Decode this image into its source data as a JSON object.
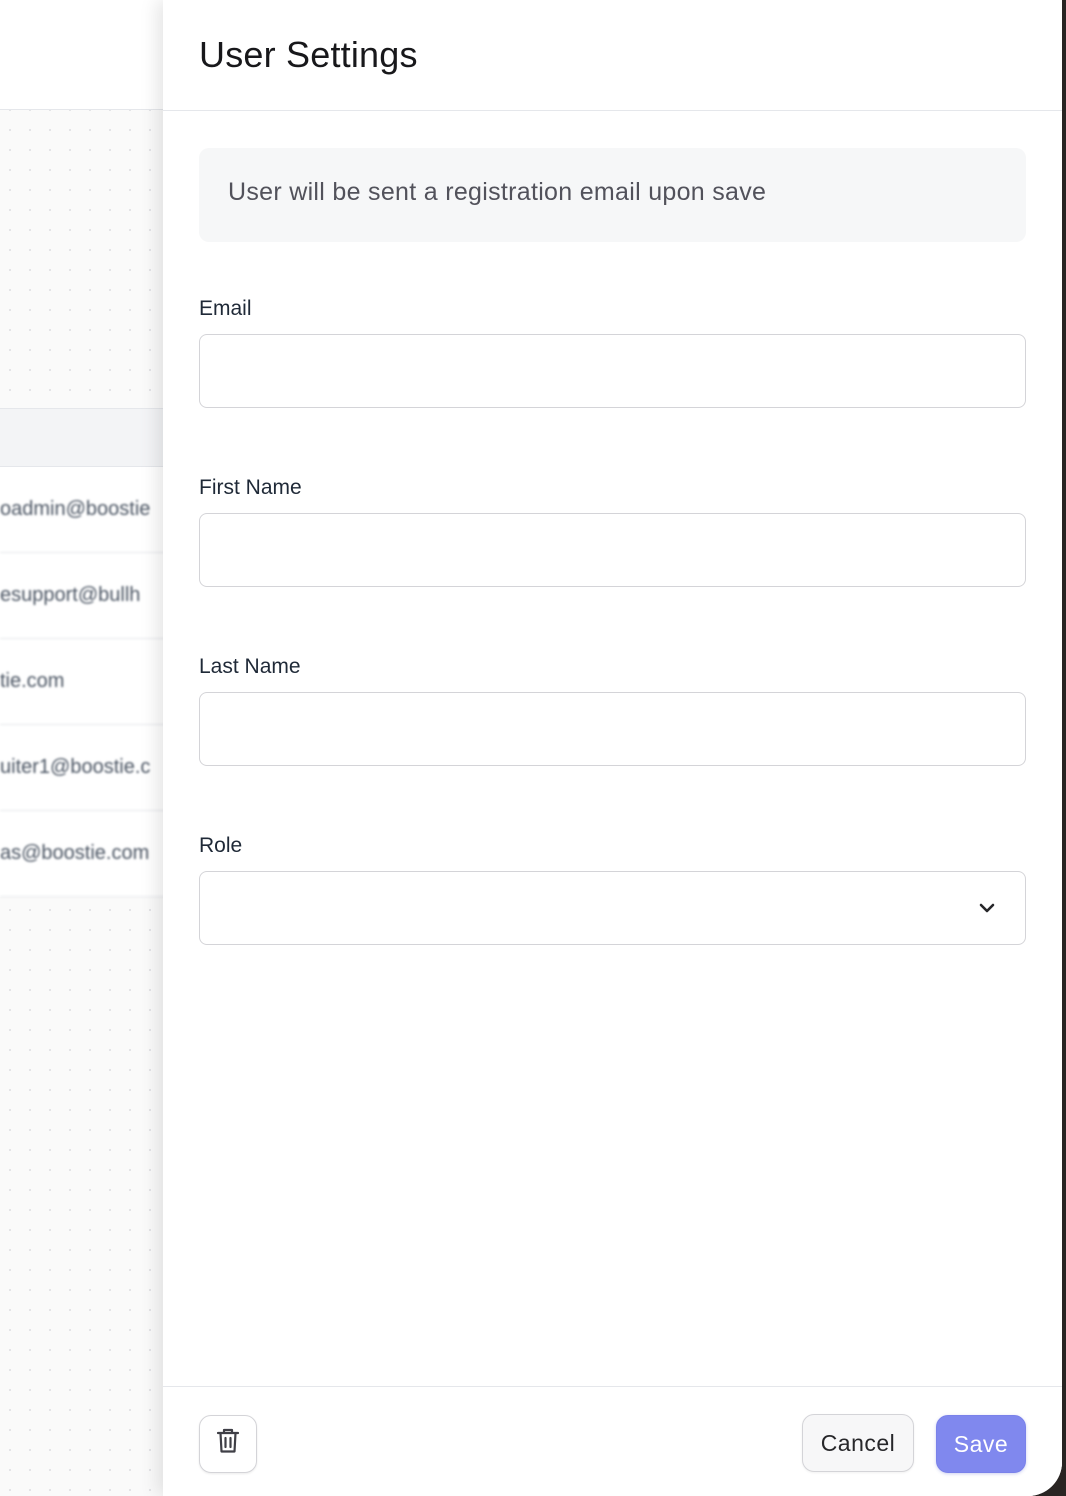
{
  "background": {
    "table_rows": [
      "oadmin@boostie",
      "esupport@bullh",
      "tie.com",
      "uiter1@boostie.c",
      "as@boostie.com"
    ]
  },
  "drawer": {
    "title": "User Settings",
    "info_message": "User will be sent a registration email upon save",
    "fields": {
      "email": {
        "label": "Email",
        "value": "",
        "placeholder": ""
      },
      "first_name": {
        "label": "First Name",
        "value": "",
        "placeholder": ""
      },
      "last_name": {
        "label": "Last Name",
        "value": "",
        "placeholder": ""
      },
      "role": {
        "label": "Role",
        "selected": "",
        "icon": "chevron-down-icon"
      }
    },
    "footer": {
      "delete_icon": "trash-icon",
      "cancel_label": "Cancel",
      "save_label": "Save"
    }
  },
  "colors": {
    "accent": "#8088ee",
    "info_box_bg": "#f6f7f8",
    "border": "#d4d4d8"
  }
}
